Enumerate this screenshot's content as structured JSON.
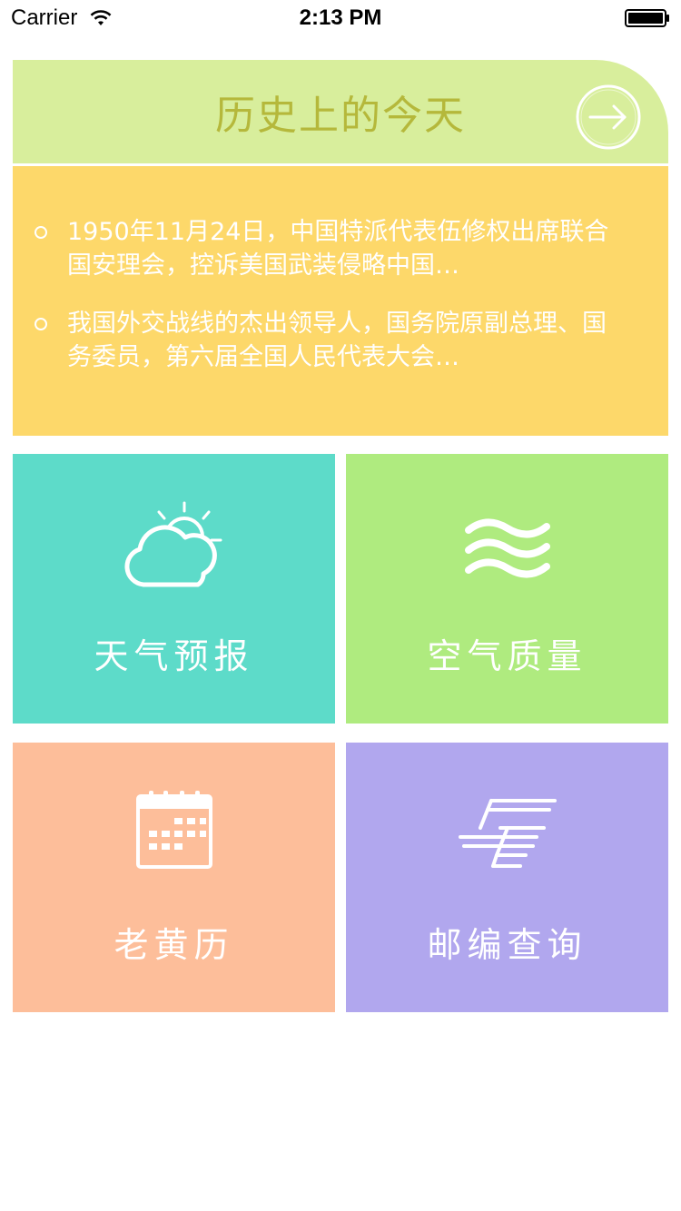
{
  "status_bar": {
    "carrier": "Carrier",
    "time": "2:13 PM"
  },
  "history": {
    "title": "历史上的今天",
    "items": [
      {
        "text": "1950年11月24日，中国特派代表伍修权出席联合国安理会，控诉美国武装侵略中国…"
      },
      {
        "text": "我国外交战线的杰出领导人，国务院原副总理、国务委员，第六届全国人民代表大会…"
      }
    ]
  },
  "tiles": {
    "weather": {
      "label": "天气预报",
      "color": "#5ddbc9",
      "icon": "cloud-sun-icon"
    },
    "air": {
      "label": "空气质量",
      "color": "#afeb7f",
      "icon": "waves-icon"
    },
    "almanac": {
      "label": "老黄历",
      "color": "#fdbe9a",
      "icon": "calendar-icon"
    },
    "postcode": {
      "label": "邮编查询",
      "color": "#b1a7ee",
      "icon": "china-post-icon"
    }
  },
  "colors": {
    "history_header": "#d8ee9c",
    "history_title": "#b5b83b",
    "history_body": "#fdd86a"
  }
}
